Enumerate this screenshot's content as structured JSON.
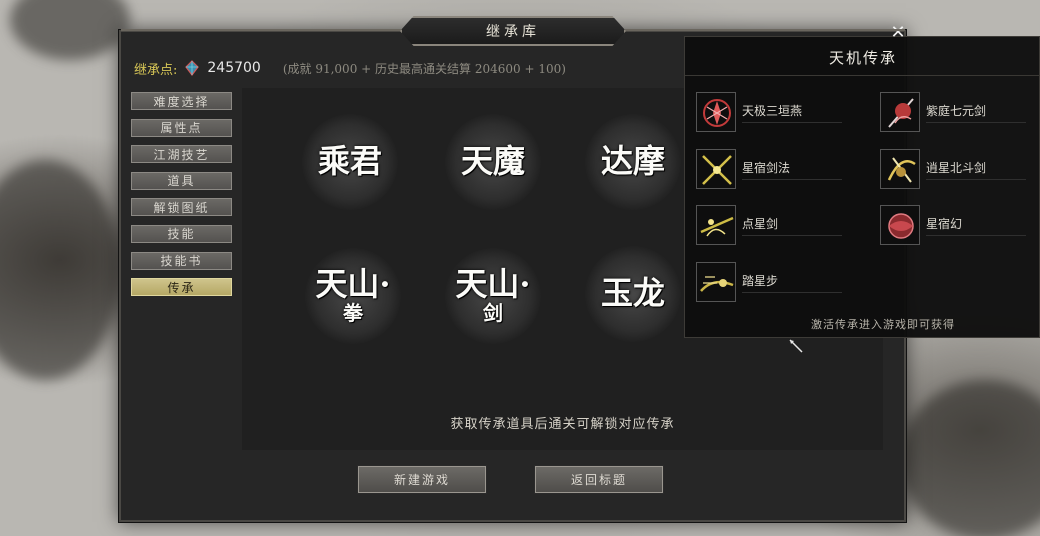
{
  "window": {
    "title": "继承库"
  },
  "header": {
    "points_label": "继承点:",
    "points_icon": "gem-icon",
    "points_value": "245700",
    "points_detail": "(成就 91,000 + 历史最高通关结算 204600 + 100)"
  },
  "sidebar": {
    "items": [
      {
        "label": "难度选择",
        "active": false
      },
      {
        "label": "属性点",
        "active": false
      },
      {
        "label": "江湖技艺",
        "active": false
      },
      {
        "label": "道具",
        "active": false
      },
      {
        "label": "解锁图纸",
        "active": false
      },
      {
        "label": "技能",
        "active": false
      },
      {
        "label": "技能书",
        "active": false
      },
      {
        "label": "传承",
        "active": true
      }
    ]
  },
  "inheritances": [
    {
      "line1": "乘君",
      "line2": ""
    },
    {
      "line1": "天魔",
      "line2": ""
    },
    {
      "line1": "达摩",
      "line2": ""
    },
    {
      "line1": "天山·",
      "line2": "拳"
    },
    {
      "line1": "天山·",
      "line2": "剑"
    },
    {
      "line1": "玉龙",
      "line2": ""
    }
  ],
  "hint": "获取传承道具后通关可解锁对应传承",
  "buttons": {
    "new_game": "新建游戏",
    "back_title": "返回标题"
  },
  "popup": {
    "title": "天机传承",
    "skills": [
      {
        "name": "天极三垣燕",
        "icon": "crimson-figure-icon",
        "color": "#c23a3a"
      },
      {
        "name": "紫庭七元剑",
        "icon": "crimson-sword-dancer-icon",
        "color": "#c44a4a"
      },
      {
        "name": "星宿剑法",
        "icon": "gold-crossed-swords-icon",
        "color": "#d4c04a"
      },
      {
        "name": "逍星北斗剑",
        "icon": "gold-sword-slash-icon",
        "color": "#e0c45a"
      },
      {
        "name": "点星剑",
        "icon": "gold-lunge-icon",
        "color": "#cdbb45"
      },
      {
        "name": "星宿幻",
        "icon": "crimson-orb-icon",
        "color": "#c8484e"
      },
      {
        "name": "踏星步",
        "icon": "gold-dash-icon",
        "color": "#cbb648"
      }
    ],
    "note": "激活传承进入游戏即可获得"
  },
  "colors": {
    "accent_gold": "#d7c656",
    "active_tab": "#c9be7f",
    "panel_bg": "#262626",
    "popup_bg": "#0e0e0e"
  }
}
